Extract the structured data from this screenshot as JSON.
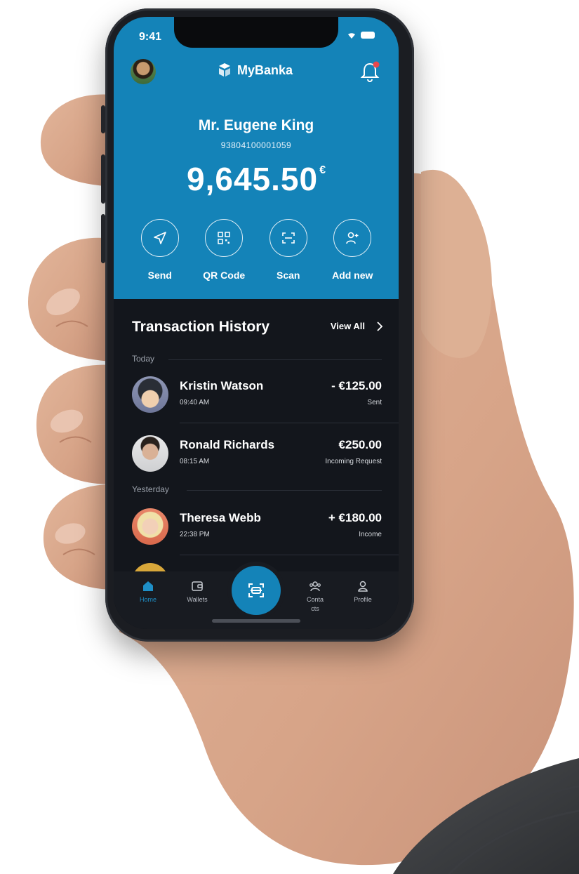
{
  "status_bar": {
    "time": "9:41"
  },
  "header": {
    "app_name": "MyBanka"
  },
  "account": {
    "owner": "Mr. Eugene King",
    "number": "93804100001059",
    "balance": "9,645.50",
    "currency": "€"
  },
  "actions": [
    {
      "label": "Send",
      "icon": "send-icon"
    },
    {
      "label": "QR Code",
      "icon": "qr-code-icon"
    },
    {
      "label": "Scan",
      "icon": "scan-icon"
    },
    {
      "label": "Add new",
      "icon": "add-user-icon"
    }
  ],
  "transactions": {
    "title": "Transaction History",
    "view_all": "View All",
    "groups": [
      {
        "label": "Today",
        "items": [
          {
            "name": "Kristin Watson",
            "time": "09:40 AM",
            "amount": "- €125.00",
            "status": "Sent"
          },
          {
            "name": "Ronald Richards",
            "time": "08:15 AM",
            "amount": "€250.00",
            "status": "Incoming Request"
          }
        ]
      },
      {
        "label": "Yesterday",
        "items": [
          {
            "name": "Theresa Webb",
            "time": "22:38 PM",
            "amount": "+ €180.00",
            "status": "Income"
          }
        ]
      }
    ]
  },
  "tabbar": {
    "items": [
      {
        "label": "Home",
        "icon": "home-icon",
        "active": true
      },
      {
        "label": "Wallets",
        "icon": "wallet-icon",
        "active": false
      },
      {
        "label": "Conta cts",
        "icon": "contacts-icon",
        "active": false
      },
      {
        "label": "Profile",
        "icon": "profile-icon",
        "active": false
      }
    ],
    "center_icon": "scan-icon"
  },
  "colors": {
    "primary": "#1483b8",
    "dark_bg": "#13161c",
    "text": "#ffffff",
    "active_tab": "#1e8fc7",
    "notification_dot": "#e8474c"
  }
}
